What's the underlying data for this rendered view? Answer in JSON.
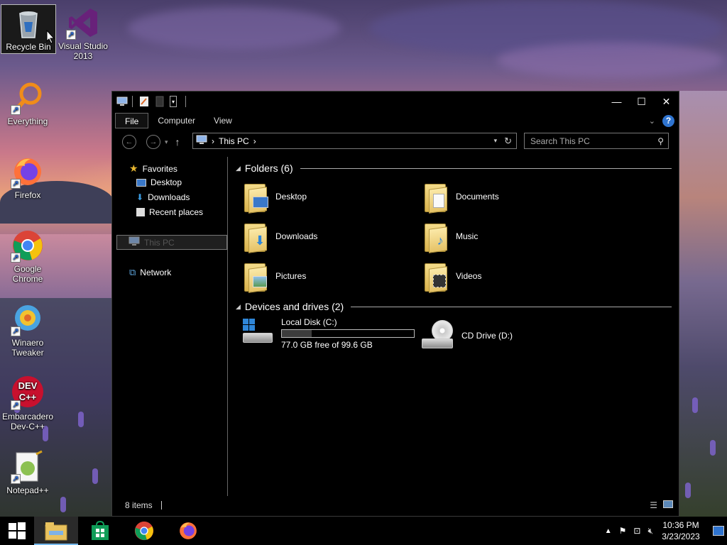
{
  "desktop": {
    "icons": [
      {
        "label": "Recycle Bin",
        "icon": "recycle-bin-icon"
      },
      {
        "label": "Visual Studio 2013",
        "icon": "visual-studio-icon"
      },
      {
        "label": "Everything",
        "icon": "everything-search-icon"
      },
      {
        "label": "Firefox",
        "icon": "firefox-icon"
      },
      {
        "label": "Google Chrome",
        "icon": "chrome-icon"
      },
      {
        "label": "Winaero Tweaker",
        "icon": "winaero-tweaker-icon"
      },
      {
        "label": "Embarcadero Dev-C++",
        "icon": "dev-cpp-icon"
      },
      {
        "label": "Notepad++",
        "icon": "notepad-plus-plus-icon"
      }
    ],
    "dev_cpp_badge": "DEV C++"
  },
  "window": {
    "title_icon": "this-pc-icon",
    "controls": {
      "minimize": "—",
      "maximize": "☐",
      "close": "✕"
    },
    "ribbon_tabs": [
      "File",
      "Computer",
      "View"
    ],
    "address": {
      "location": "This PC",
      "separator": "›"
    },
    "search": {
      "placeholder": "Search This PC"
    },
    "nav": {
      "favorites": "Favorites",
      "desktop": "Desktop",
      "downloads": "Downloads",
      "recent": "Recent places",
      "this_pc": "This PC",
      "network": "Network"
    },
    "groups": {
      "folders": "Folders (6)",
      "devices": "Devices and drives (2)"
    },
    "folders": [
      "Desktop",
      "Documents",
      "Downloads",
      "Music",
      "Pictures",
      "Videos"
    ],
    "drives": {
      "local": {
        "name": "Local Disk (C:)",
        "free_text": "77.0 GB free of 99.6 GB",
        "used_fraction": 0.227
      },
      "cd": {
        "name": "CD Drive (D:)"
      }
    },
    "status": {
      "items": "8 items"
    }
  },
  "taskbar": {
    "time": "10:36 PM",
    "date": "3/23/2023",
    "apps": [
      "start-button",
      "file-explorer",
      "store",
      "chrome",
      "firefox"
    ]
  },
  "colors": {
    "accent": "#2f74d0",
    "folder": "#e5c266",
    "window_bg": "#000000"
  }
}
